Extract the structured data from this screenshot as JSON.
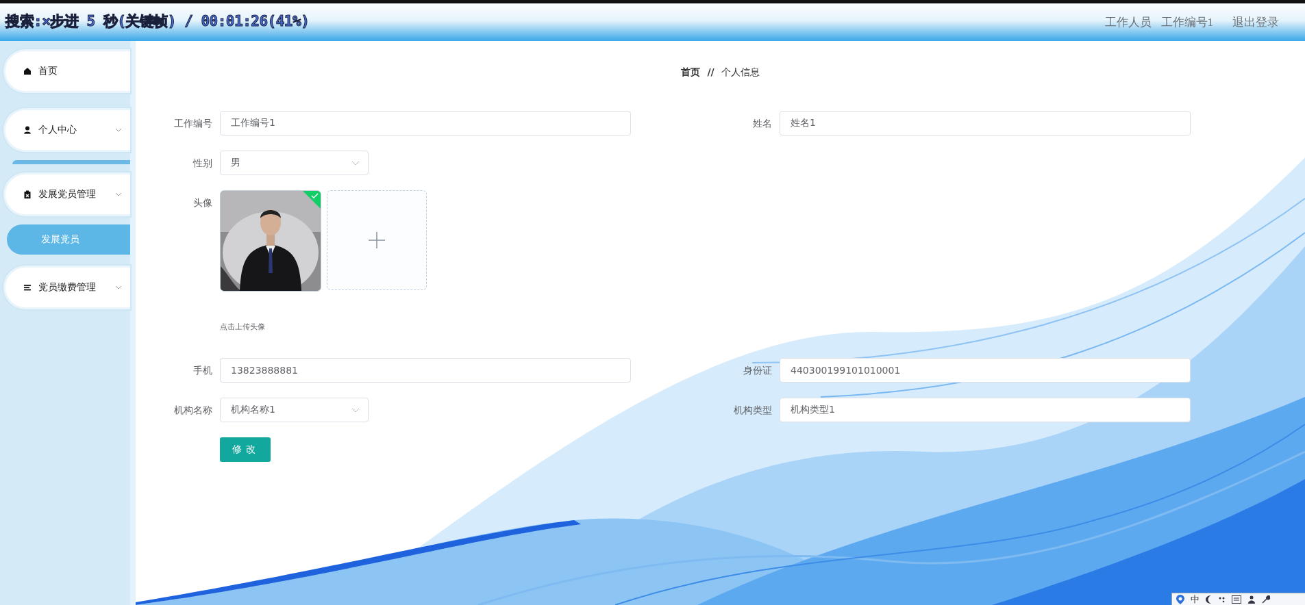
{
  "video_overlay": {
    "text": "搜索:×步进 5 秒(关键帧) / 00:01:26(41%)"
  },
  "header": {
    "role": "工作人员",
    "user": "工作编号1",
    "logout": "退出登录"
  },
  "sidebar": {
    "items": [
      {
        "kind": "link",
        "label": "首页",
        "selected": false
      },
      {
        "kind": "submenu",
        "label": "个人中心",
        "selected": false
      },
      {
        "kind": "submenu",
        "label": "发展党员管理",
        "selected": false,
        "children": [
          {
            "label": "发展党员",
            "selected": true
          }
        ]
      },
      {
        "kind": "submenu",
        "label": "党员缴费管理",
        "selected": false
      }
    ]
  },
  "breadcrumb": {
    "items": [
      "首页",
      "个人信息"
    ],
    "separator": "//"
  },
  "form": {
    "rows": [
      [
        {
          "kind": "input",
          "label": "工作编号",
          "value": "工作编号1"
        },
        {
          "kind": "input",
          "label": "姓名",
          "value": "姓名1"
        }
      ],
      [
        {
          "kind": "select",
          "label": "性别",
          "value": "男"
        }
      ],
      [
        {
          "kind": "avatar",
          "label": "头像",
          "hint": "点击上传头像",
          "uploaded": true
        }
      ],
      [
        {
          "kind": "input",
          "label": "手机",
          "value": "13823888881"
        },
        {
          "kind": "input",
          "label": "身份证",
          "value": "440300199101010001"
        }
      ],
      [
        {
          "kind": "select",
          "label": "机构名称",
          "value": "机构名称1"
        },
        {
          "kind": "input",
          "label": "机构类型",
          "value": "机构类型1"
        }
      ]
    ],
    "submit": "修改"
  },
  "ime_bar": {
    "mode": "中"
  }
}
